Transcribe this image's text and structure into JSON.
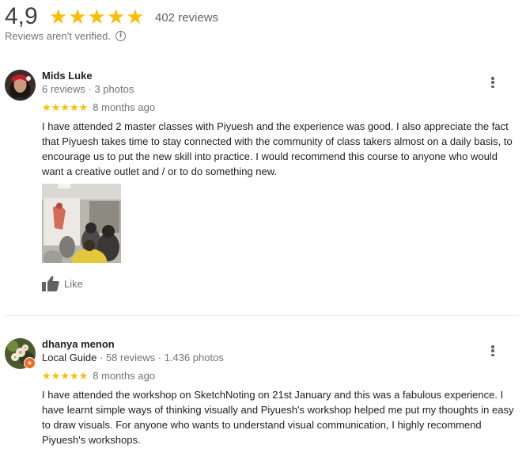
{
  "summary": {
    "rating": "4,9",
    "stars": 5,
    "review_count": "402 reviews",
    "notice": "Reviews aren't verified."
  },
  "reviews": [
    {
      "author": "Mids Luke",
      "meta": "6 reviews · 3 photos",
      "stars": 5,
      "time": "8 months ago",
      "text": "I have attended 2 master classes with Piyuesh and the experience was good. I also appreciate the fact that Piyuesh takes time to stay connected with the community of class takers almost on a daily basis, to encourage us to put the new skill into practice. I would recommend this course to anyone who would want a creative outlet and / or to do something new.",
      "like_label": "Like"
    },
    {
      "author": "dhanya menon",
      "badge": "Local Guide",
      "meta": "58 reviews · 1.436 photos",
      "stars": 5,
      "time": "8 months ago",
      "text": "I have attended the workshop on SketchNoting on 21st January and this was a fabulous experience. I have learnt simple ways of thinking visually and Piyuesh's workshop helped me put my thoughts in easy to draw visuals. For anyone who wants to understand visual communication, I highly recommend Piyuesh's workshops."
    }
  ],
  "colors": {
    "star": "#fbbc04",
    "secondary_text": "#70757a",
    "primary_text": "#202124",
    "divider": "#e8eaed",
    "local_guide_badge": "#f06b20"
  },
  "icons": {
    "more_options": "more-vert-icon",
    "like": "thumbs-up-icon",
    "info": "info-icon"
  }
}
